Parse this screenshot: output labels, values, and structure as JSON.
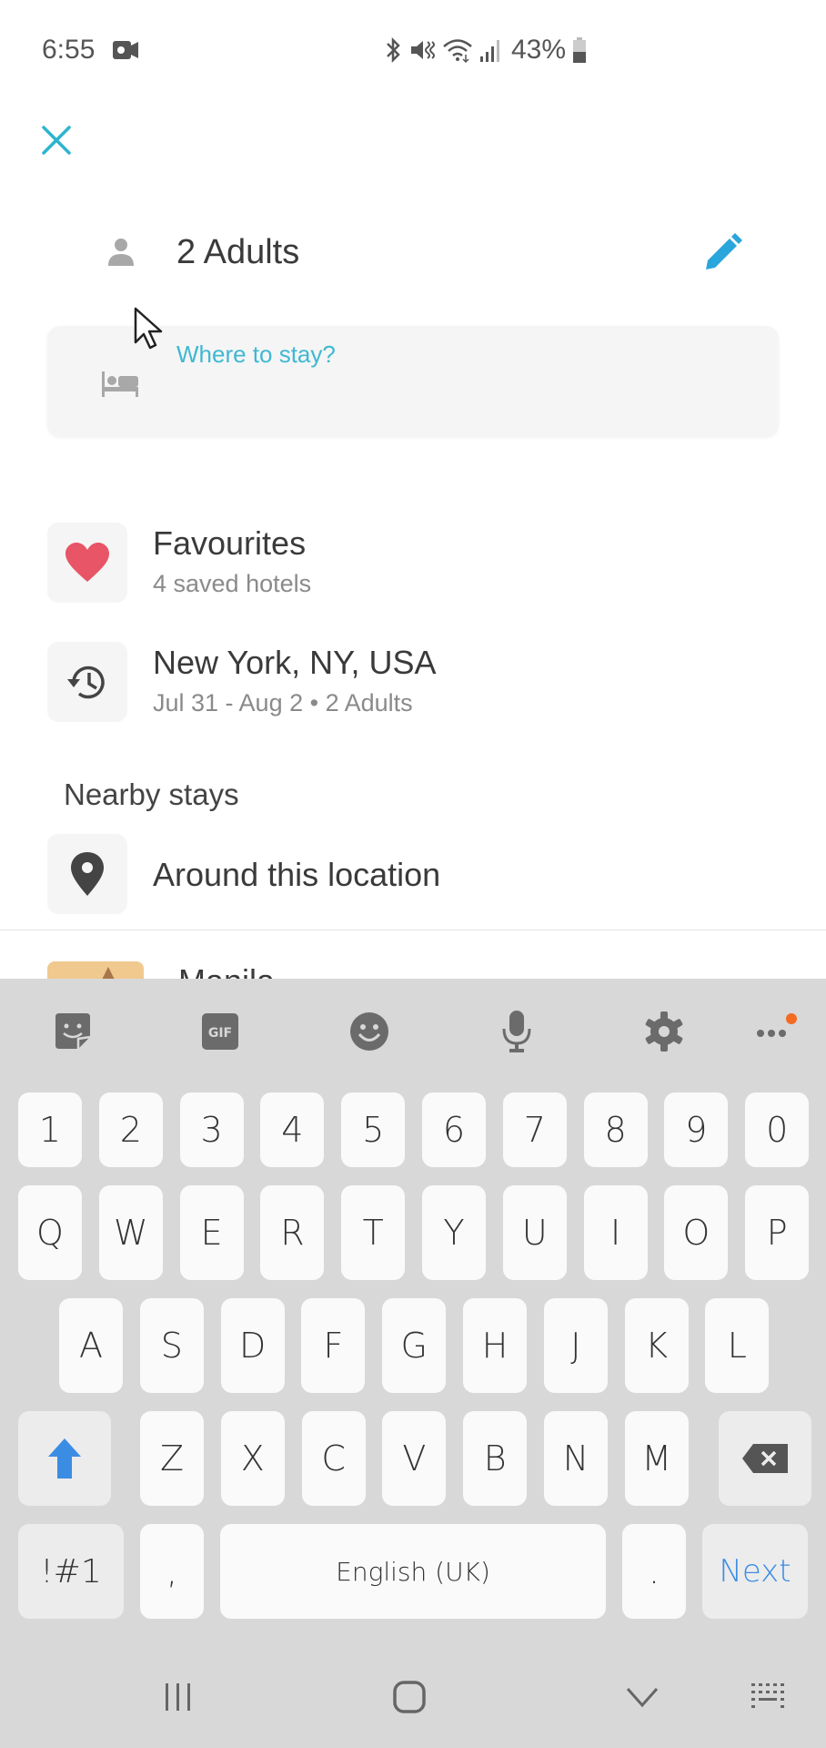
{
  "status_bar": {
    "time": "6:55",
    "battery_percent": "43%",
    "icons": [
      "screen-record-icon",
      "bluetooth-icon",
      "mute-vibrate-icon",
      "wifi-icon",
      "signal-icon",
      "battery-icon"
    ]
  },
  "header": {
    "close_icon": "close-icon",
    "guests_label": "2 Adults",
    "edit_icon": "pencil-icon"
  },
  "search": {
    "placeholder": "Where to stay?",
    "icon": "bed-icon"
  },
  "list": {
    "items": [
      {
        "title": "Favourites",
        "subtitle": "4 saved hotels",
        "icon": "heart-icon"
      },
      {
        "title": "New York, NY, USA",
        "subtitle": "Jul 31 - Aug 2 • 2 Adults",
        "icon": "history-icon"
      }
    ]
  },
  "nearby": {
    "heading": "Nearby stays",
    "items": [
      {
        "title": "Around this location",
        "icon": "location-pin-icon"
      }
    ],
    "partial_item_text": "Manila"
  },
  "keyboard": {
    "toolbar": [
      "sticker-icon",
      "gif-icon",
      "emoji-icon",
      "microphone-icon",
      "settings-icon",
      "more-icon"
    ],
    "gif_label": "GIF",
    "number_row": [
      "1",
      "2",
      "3",
      "4",
      "5",
      "6",
      "7",
      "8",
      "9",
      "0"
    ],
    "row1": [
      "Q",
      "W",
      "E",
      "R",
      "T",
      "Y",
      "U",
      "I",
      "O",
      "P"
    ],
    "row2": [
      "A",
      "S",
      "D",
      "F",
      "G",
      "H",
      "J",
      "K",
      "L"
    ],
    "row3": [
      "Z",
      "X",
      "C",
      "V",
      "B",
      "N",
      "M"
    ],
    "symbols_label": "!#1",
    "comma_label": ",",
    "space_label": "English (UK)",
    "period_label": ".",
    "action_label": "Next"
  },
  "nav_bar": {
    "buttons": [
      "recent-apps-icon",
      "home-icon",
      "hide-keyboard-icon",
      "keyboard-switch-icon"
    ]
  },
  "colors": {
    "accent": "#3fb8d2",
    "edit_blue": "#2aa6dc",
    "heart": "#e85566",
    "keyboard_blue": "#3b8de4",
    "notification_dot": "#f26b21"
  }
}
